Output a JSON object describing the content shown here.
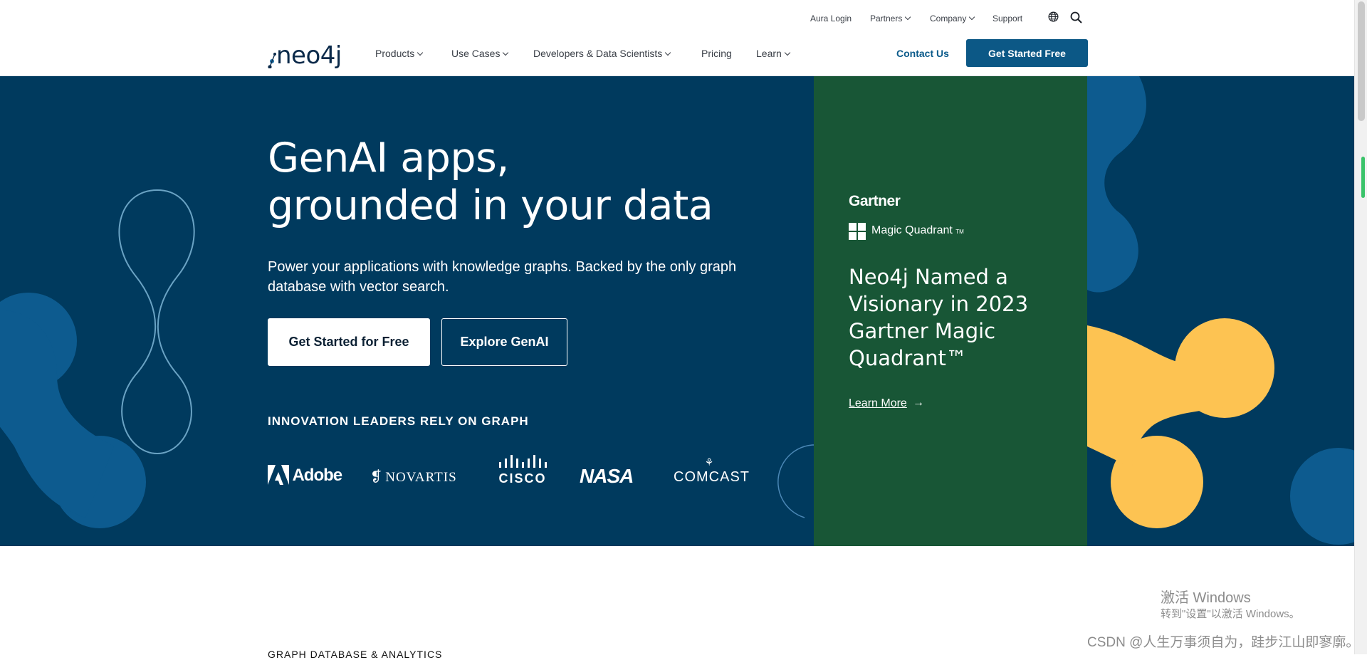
{
  "utility": {
    "aura_login": "Aura Login",
    "partners": "Partners",
    "company": "Company",
    "support": "Support"
  },
  "nav": {
    "logo": "neo4j",
    "items": [
      "Products",
      "Use Cases",
      "Developers & Data Scientists",
      "Pricing",
      "Learn"
    ],
    "contact": "Contact Us",
    "cta": "Get Started Free"
  },
  "hero": {
    "title_line1": "GenAI apps,",
    "title_line2": "grounded in your data",
    "subtitle": "Power your applications with knowledge graphs. Backed by the only graph database with vector search.",
    "primary_button": "Get Started for Free",
    "secondary_button": "Explore GenAI",
    "leaders_heading": "INNOVATION LEADERS RELY ON GRAPH",
    "logos": [
      "Adobe",
      "NOVARTIS",
      "CISCO",
      "NASA",
      "COMCAST"
    ]
  },
  "promo": {
    "brand": "Gartner",
    "badge": "Magic Quadrant",
    "badge_tm": "TM",
    "title": "Neo4j Named a Visionary in 2023 Gartner Magic Quadrant™",
    "link": "Learn More",
    "arrow": "→"
  },
  "section": {
    "label": "GRAPH DATABASE & ANALYTICS"
  },
  "watermark": {
    "line1": "激活 Windows",
    "line2": "转到\"设置\"以激活 Windows。",
    "csdn": "CSDN @人生万事须自为，跬步江山即寥廓。"
  },
  "colors": {
    "hero_bg": "#003a5e",
    "promo_bg": "#185636",
    "accent_blue": "#0c5886",
    "blob_blue": "#0d5b8f",
    "blob_yellow": "#fdc352"
  }
}
